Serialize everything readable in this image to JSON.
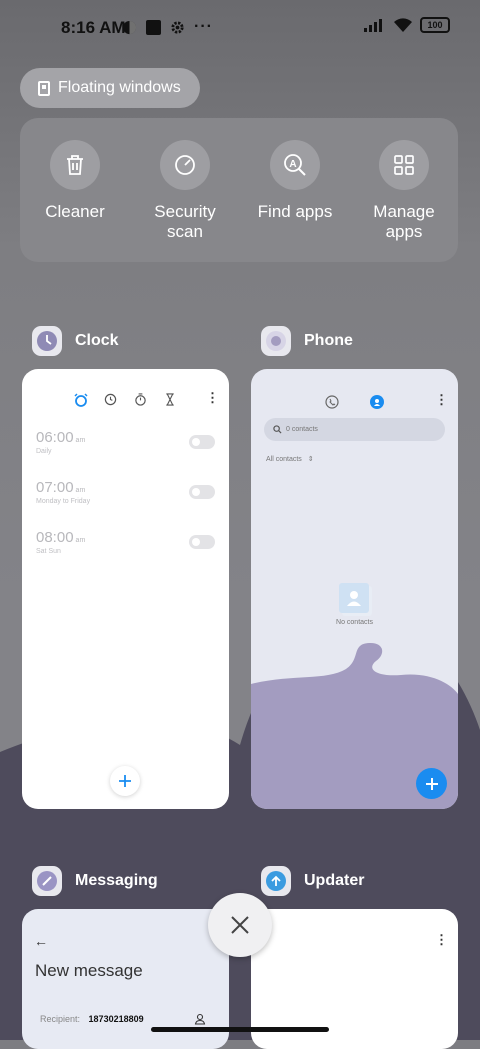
{
  "status_bar": {
    "time": "8:16 AM",
    "battery": "100"
  },
  "floating_windows": {
    "label": "Floating windows"
  },
  "tools": [
    {
      "label_line1": "Cleaner",
      "label_line2": "",
      "icon": "trash-icon"
    },
    {
      "label_line1": "Security",
      "label_line2": "scan",
      "icon": "security-scan-icon"
    },
    {
      "label_line1": "Find apps",
      "label_line2": "",
      "icon": "find-apps-icon"
    },
    {
      "label_line1": "Manage",
      "label_line2": "apps",
      "icon": "grid-icon"
    }
  ],
  "apps": {
    "clock": {
      "name": "Clock",
      "alarms": [
        {
          "time": "06:00",
          "ampm": "am",
          "repeat": "Daily"
        },
        {
          "time": "07:00",
          "ampm": "am",
          "repeat": "Monday to Friday"
        },
        {
          "time": "08:00",
          "ampm": "am",
          "repeat": "Sat Sun"
        }
      ]
    },
    "phone": {
      "name": "Phone",
      "search_placeholder": "0 contacts",
      "filter": "All contacts",
      "empty_text": "No contacts"
    },
    "messaging": {
      "name": "Messaging",
      "title": "New message",
      "recipient_label": "Recipient:",
      "recipient_value": "18730218809"
    },
    "updater": {
      "name": "Updater"
    }
  },
  "colors": {
    "accent_blue": "#1a8cf0",
    "wave_purple": "#a39cc0"
  }
}
